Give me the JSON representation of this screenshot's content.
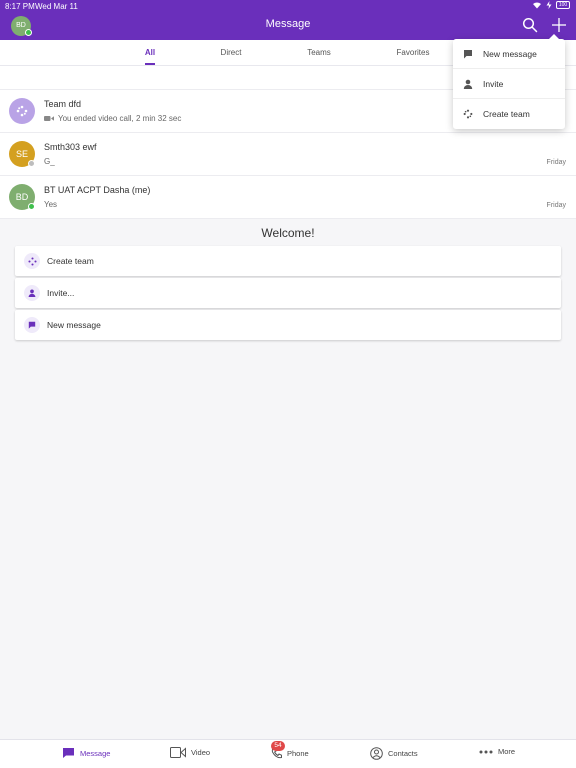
{
  "status_bar": {
    "time": "8:17 PM",
    "date": "Wed Mar 11",
    "battery": "100"
  },
  "header": {
    "title": "Message",
    "avatar_initials": "BD"
  },
  "tabs": [
    "All",
    "Direct",
    "Teams",
    "Favorites"
  ],
  "conversations": [
    {
      "name": "Team dfd",
      "preview": "You ended video call, 2 min 32 sec",
      "time": "",
      "initials": ""
    },
    {
      "name": "Smth303 ewf",
      "preview": "G_",
      "time": "Friday",
      "initials": "SE"
    },
    {
      "name": "BT UAT ACPT Dasha (me)",
      "preview": "Yes",
      "time": "Friday",
      "initials": "BD"
    }
  ],
  "welcome": {
    "title": "Welcome!",
    "actions": [
      "Create team",
      "Invite...",
      "New message"
    ]
  },
  "dropdown": {
    "items": [
      "New message",
      "Invite",
      "Create team"
    ]
  },
  "bottom_nav": {
    "items": [
      "Message",
      "Video",
      "Phone",
      "Contacts",
      "More"
    ],
    "phone_badge": "54"
  },
  "colors": {
    "accent": "#6a2fbb",
    "presence": "#3ec04c",
    "badge": "#e04848"
  }
}
